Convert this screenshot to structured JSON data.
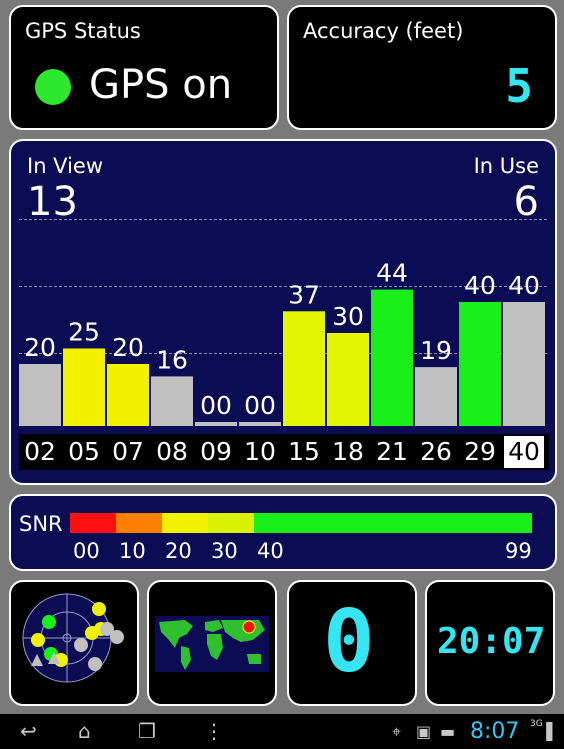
{
  "gps_status": {
    "title": "GPS Status",
    "value": "GPS on",
    "indicator_color": "#2ee82e"
  },
  "accuracy": {
    "title": "Accuracy (feet)",
    "value": "5"
  },
  "satellites": {
    "in_view_label": "In View",
    "in_view": "13",
    "in_use_label": "In Use",
    "in_use": "6",
    "bars": [
      {
        "prn": "02",
        "snr": 20,
        "label": "20",
        "color": "#c0c0c0"
      },
      {
        "prn": "05",
        "snr": 25,
        "label": "25",
        "color": "#f2f200"
      },
      {
        "prn": "07",
        "snr": 20,
        "label": "20",
        "color": "#f2f200"
      },
      {
        "prn": "08",
        "snr": 16,
        "label": "16",
        "color": "#c0c0c0"
      },
      {
        "prn": "09",
        "snr": 0,
        "label": "00",
        "color": "#c0c0c0"
      },
      {
        "prn": "10",
        "snr": 0,
        "label": "00",
        "color": "#c0c0c0"
      },
      {
        "prn": "15",
        "snr": 37,
        "label": "37",
        "color": "#e3f600"
      },
      {
        "prn": "18",
        "snr": 30,
        "label": "30",
        "color": "#e3f600"
      },
      {
        "prn": "21",
        "snr": 44,
        "label": "44",
        "color": "#19f019"
      },
      {
        "prn": "26",
        "snr": 19,
        "label": "19",
        "color": "#c0c0c0"
      },
      {
        "prn": "29",
        "snr": 40,
        "label": "40",
        "color": "#19f019"
      },
      {
        "prn": "40",
        "snr": 40,
        "label": "40",
        "color": "#c0c0c0"
      }
    ],
    "highlighted_prn": "40"
  },
  "snr_scale": {
    "label": "SNR",
    "ticks": [
      "00",
      "10",
      "20",
      "30",
      "40",
      "99"
    ],
    "colors": [
      "#ff1010",
      "#ff8000",
      "#f2f200",
      "#d8f200",
      "#19f019"
    ]
  },
  "sat_count_display": "0",
  "clock": "20:07",
  "status_bar": {
    "time": "8:07",
    "network": "3G"
  }
}
